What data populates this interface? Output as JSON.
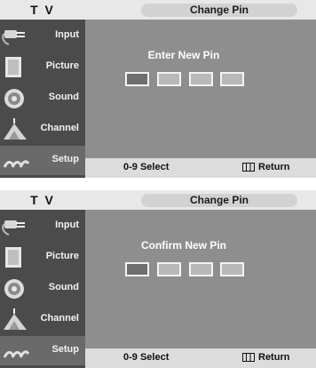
{
  "screens": [
    {
      "tv_label": "T V",
      "title": "Change Pin",
      "menu": [
        {
          "label": "Input",
          "icon": "input-plug-icon"
        },
        {
          "label": "Picture",
          "icon": "picture-icon"
        },
        {
          "label": "Sound",
          "icon": "speaker-icon"
        },
        {
          "label": "Channel",
          "icon": "antenna-icon"
        },
        {
          "label": "Setup",
          "icon": "setup-gears-icon"
        }
      ],
      "active_menu": "Setup",
      "prompt": "Enter New Pin",
      "pin_boxes": 4,
      "active_pin_index": 0,
      "footer": {
        "select": "0-9 Select",
        "return": "Return"
      }
    },
    {
      "tv_label": "T V",
      "title": "Change Pin",
      "menu": [
        {
          "label": "Input",
          "icon": "input-plug-icon"
        },
        {
          "label": "Picture",
          "icon": "picture-icon"
        },
        {
          "label": "Sound",
          "icon": "speaker-icon"
        },
        {
          "label": "Channel",
          "icon": "antenna-icon"
        },
        {
          "label": "Setup",
          "icon": "setup-gears-icon"
        }
      ],
      "active_menu": "Setup",
      "prompt": "Confirm New Pin",
      "pin_boxes": 4,
      "active_pin_index": 0,
      "footer": {
        "select": "0-9 Select",
        "return": "Return"
      }
    }
  ],
  "colors": {
    "sidebar": "#4b4b4b",
    "content": "#8e8e8e",
    "pin_active": "#6e6e6e",
    "pin_inactive": "#b8b8b8"
  }
}
